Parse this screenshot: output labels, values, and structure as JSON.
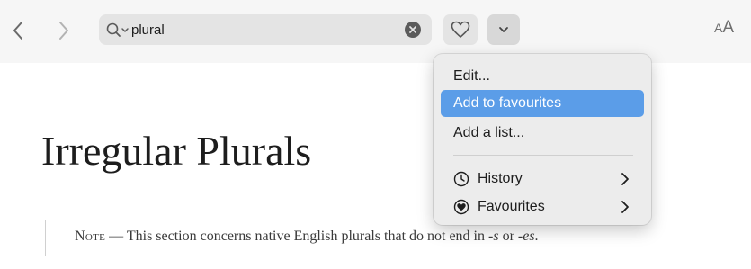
{
  "toolbar": {
    "back_icon": "chevron-left-icon",
    "forward_icon": "chevron-right-icon",
    "search": {
      "icon": "magnifier-with-dropdown-icon",
      "value": "plural",
      "clear_icon": "clear-circle-icon"
    },
    "favourite_icon": "heart-outline-icon",
    "menu_icon": "chevron-down-icon",
    "text_size": {
      "small": "A",
      "large": "A"
    }
  },
  "article": {
    "title": "Irregular Plurals",
    "note": {
      "label": "Note",
      "dash": " — ",
      "text_before": "This section concerns native English plurals that do not end in ",
      "suffix_s": "-s",
      "text_or": " or ",
      "suffix_es": "-es",
      "text_end": "."
    }
  },
  "menu": {
    "items": [
      {
        "label": "Edit...",
        "highlighted": false
      },
      {
        "label": "Add to favourites",
        "highlighted": true
      },
      {
        "label": "Add a list...",
        "highlighted": false
      },
      {
        "label": "History",
        "icon": "clock-icon",
        "submenu": true
      },
      {
        "label": "Favourites",
        "icon": "heart-filled-circle-icon",
        "submenu": true
      }
    ]
  },
  "colors": {
    "highlight": "#5b9de8",
    "toolbar_bg": "#f6f6f6",
    "menu_bg": "#ececec",
    "text": "#1d1d1d"
  }
}
